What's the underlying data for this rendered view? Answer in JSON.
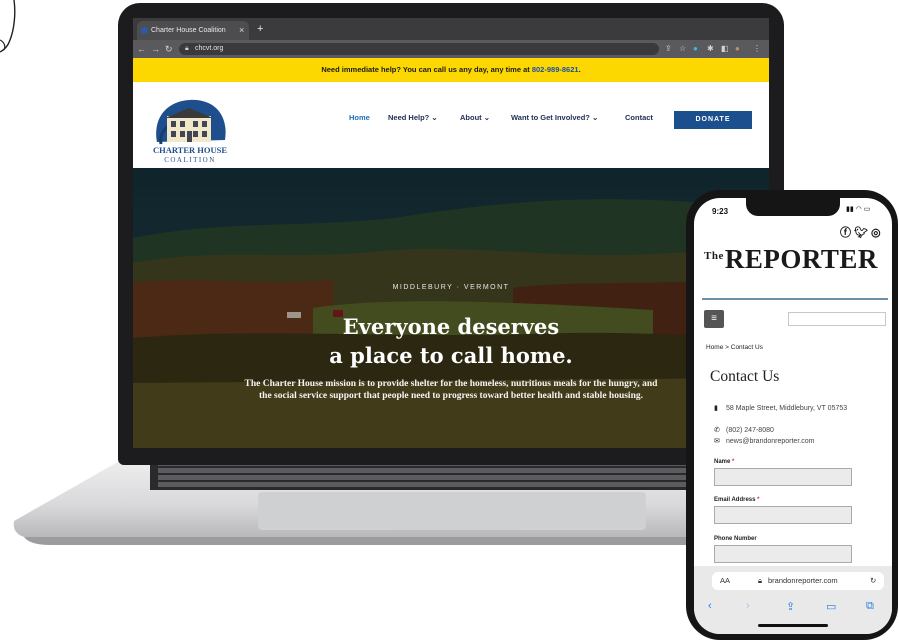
{
  "browser": {
    "tab_title": "Charter House Coalition",
    "tab_close": "×",
    "new_tab": "+",
    "url": "chcvt.org",
    "back_icon": "arrow-left",
    "forward_icon": "arrow-right",
    "reload_icon": "reload"
  },
  "site": {
    "alert_text": "Need immediate help? You can call us any day, any time at ",
    "alert_phone": "802-989-8621",
    "alert_end": ".",
    "logo_line1": "CHARTER HOUSE",
    "logo_line2": "COALITION",
    "nav": [
      {
        "label": "Home"
      },
      {
        "label": "Need Help? ⌄"
      },
      {
        "label": "About ⌄"
      },
      {
        "label": "Want to Get Involved? ⌄"
      },
      {
        "label": "Contact"
      }
    ],
    "donate_label": "DONATE",
    "hero_kicker": "MIDDLEBURY · VERMONT",
    "hero_title_line1": "Everyone deserves",
    "hero_title_line2": "a place to call home.",
    "hero_body": "The Charter House mission is to provide shelter for the homeless, nutritious meals for the hungry, and the social service support that people need to progress toward better health and stable housing.",
    "colors": {
      "alert": "#fcd800",
      "donate": "#1c4f8e",
      "nav_active": "#1e6db7"
    }
  },
  "phone": {
    "time": "9:23",
    "masthead_the": "The",
    "masthead": "REPORTER",
    "social_icons": [
      "facebook-icon",
      "twitter-icon",
      "instagram-icon"
    ],
    "breadcrumb": "Home  >  Contact Us",
    "page_title": "Contact Us",
    "address": "58 Maple Street, Middlebury, VT 05753",
    "phone_number": "(802) 247-8080",
    "email": "news@brandonreporter.com",
    "form": {
      "name_label": "Name",
      "email_label": "Email Address",
      "phone_label": "Phone Number",
      "required_mark": "*"
    },
    "safari": {
      "aa": "AA",
      "url": "brandonreporter.com"
    }
  }
}
